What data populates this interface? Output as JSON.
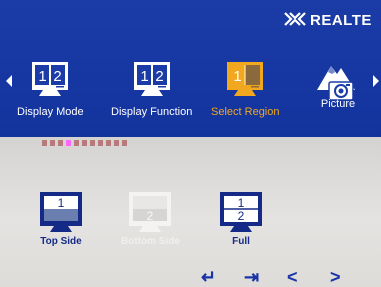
{
  "brand": {
    "name": "REALTE"
  },
  "menu": {
    "items": [
      {
        "label": "Display Mode",
        "icon": "two-region-monitor-icon",
        "num_left": "1",
        "num_right": "2"
      },
      {
        "label": "Display Function",
        "icon": "two-region-monitor-icon",
        "num_left": "1",
        "num_right": "2"
      },
      {
        "label": "Select Region",
        "icon": "select-region-monitor-icon",
        "num_left": "1",
        "num_right": "",
        "selected": true
      },
      {
        "label": "Picture",
        "icon": "picture-icon"
      }
    ]
  },
  "pagination": {
    "total": 11,
    "active_index": 3
  },
  "submenu": {
    "options": [
      {
        "label": "Top Side",
        "top": "1",
        "bottom": "",
        "enabled": true
      },
      {
        "label": "Bottom Side",
        "top": "",
        "bottom": "2",
        "enabled": false
      },
      {
        "label": "Full",
        "top": "1",
        "bottom": "2",
        "enabled": true
      }
    ]
  },
  "nav_buttons": [
    {
      "name": "enter-icon",
      "glyph": "↵"
    },
    {
      "name": "exit-icon",
      "glyph": "⇥"
    },
    {
      "name": "left-icon",
      "glyph": "<"
    },
    {
      "name": "right-icon",
      "glyph": ">"
    }
  ],
  "colors": {
    "osd_blue": "#1636a2",
    "panel_gray": "#e0dfdd",
    "selected": "#f2a81e",
    "label_blue": "#152a86"
  }
}
